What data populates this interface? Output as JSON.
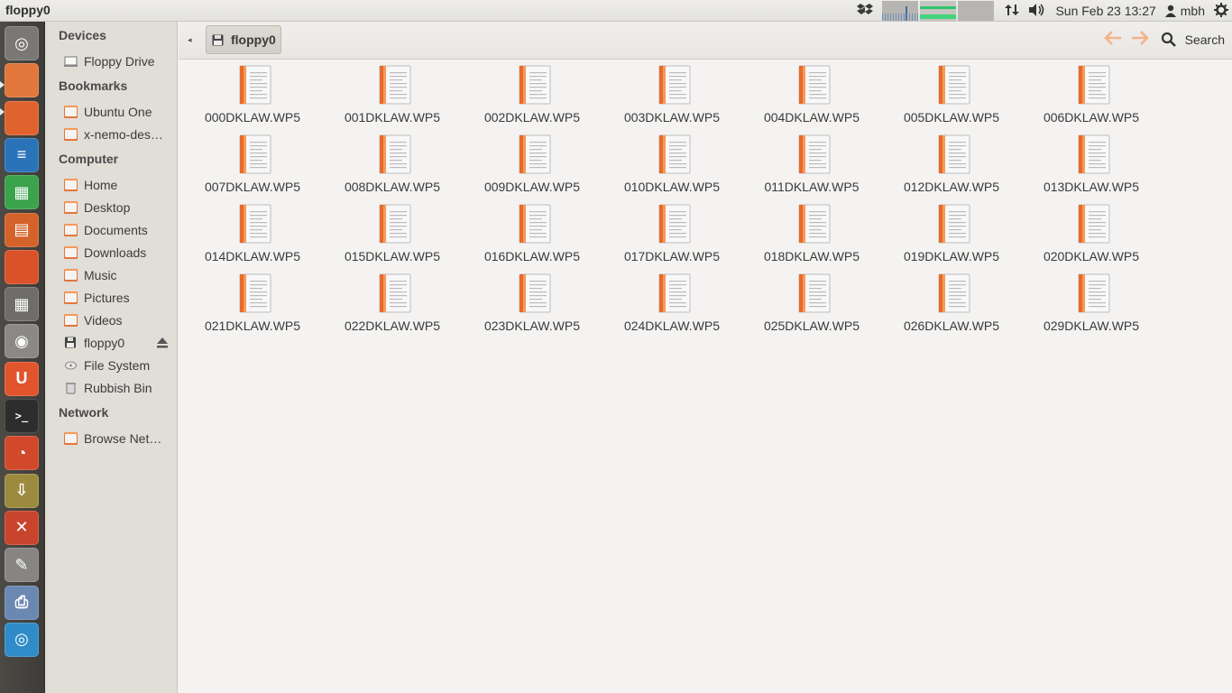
{
  "window": {
    "title": "floppy0"
  },
  "panel": {
    "datetime": "Sun Feb 23 13:27",
    "user": "mbh"
  },
  "launcher": {
    "items": [
      {
        "name": "dash-home",
        "color": "#7a7874"
      },
      {
        "name": "files",
        "color": "#e2773c"
      },
      {
        "name": "firefox",
        "color": "#e0632e"
      },
      {
        "name": "libreoffice-writer",
        "color": "#2b73b9"
      },
      {
        "name": "libreoffice-calc",
        "color": "#3aa34b"
      },
      {
        "name": "libreoffice-impress",
        "color": "#d4622a"
      },
      {
        "name": "ubuntu-software",
        "color": "#d9522a"
      },
      {
        "name": "calculator",
        "color": "#6f6d69"
      },
      {
        "name": "camera",
        "color": "#8b8985"
      },
      {
        "name": "ubuntu-one",
        "color": "#e0552c"
      },
      {
        "name": "terminal",
        "color": "#2d2d2d"
      },
      {
        "name": "chart-app",
        "color": "#d2482b"
      },
      {
        "name": "archive-manager",
        "color": "#9c8a3f"
      },
      {
        "name": "settings-tool",
        "color": "#c9442d"
      },
      {
        "name": "system-settings",
        "color": "#878582"
      },
      {
        "name": "printer",
        "color": "#6b88b3"
      },
      {
        "name": "dvd-drive",
        "color": "#2f8cc8"
      }
    ]
  },
  "sidebar": {
    "devices_heading": "Devices",
    "devices": [
      {
        "label": "Floppy Drive"
      }
    ],
    "bookmarks_heading": "Bookmarks",
    "bookmarks": [
      {
        "label": "Ubuntu One"
      },
      {
        "label": "x-nemo-des…"
      }
    ],
    "computer_heading": "Computer",
    "computer": [
      {
        "label": "Home"
      },
      {
        "label": "Desktop"
      },
      {
        "label": "Documents"
      },
      {
        "label": "Downloads"
      },
      {
        "label": "Music"
      },
      {
        "label": "Pictures"
      },
      {
        "label": "Videos"
      },
      {
        "label": "floppy0"
      },
      {
        "label": "File System"
      },
      {
        "label": "Rubbish Bin"
      }
    ],
    "network_heading": "Network",
    "network": [
      {
        "label": "Browse Net…"
      }
    ]
  },
  "toolbar": {
    "breadcrumb": "floppy0",
    "search_label": "Search"
  },
  "files": [
    "000DKLAW.WP5",
    "001DKLAW.WP5",
    "002DKLAW.WP5",
    "003DKLAW.WP5",
    "004DKLAW.WP5",
    "005DKLAW.WP5",
    "006DKLAW.WP5",
    "007DKLAW.WP5",
    "008DKLAW.WP5",
    "009DKLAW.WP5",
    "010DKLAW.WP5",
    "011DKLAW.WP5",
    "012DKLAW.WP5",
    "013DKLAW.WP5",
    "014DKLAW.WP5",
    "015DKLAW.WP5",
    "016DKLAW.WP5",
    "017DKLAW.WP5",
    "018DKLAW.WP5",
    "019DKLAW.WP5",
    "020DKLAW.WP5",
    "021DKLAW.WP5",
    "022DKLAW.WP5",
    "023DKLAW.WP5",
    "024DKLAW.WP5",
    "025DKLAW.WP5",
    "026DKLAW.WP5",
    "029DKLAW.WP5"
  ]
}
